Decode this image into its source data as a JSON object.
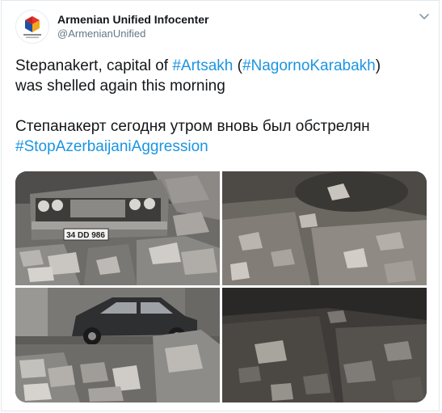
{
  "account": {
    "display_name": "Armenian Unified Infocenter",
    "handle": "@ArmenianUnified"
  },
  "tweet": {
    "line1_prefix": "Stepanakert, capital of ",
    "hashtag1": "#Artsakh",
    "paren_open": " (",
    "hashtag2": "#NagornoKarabakh",
    "paren_close": ")",
    "line2": "was shelled again this morning",
    "russian_line": "Степанакерт сегодня утром вновь был обстрелян",
    "hashtag3": "#StopAzerbaijaniAggression"
  },
  "media": {
    "plate_text": "34 DD 986"
  },
  "colors": {
    "link": "#1b95e0",
    "text": "#14171a",
    "secondary": "#657786"
  },
  "icons": {
    "caret": "chevron-down-icon"
  }
}
